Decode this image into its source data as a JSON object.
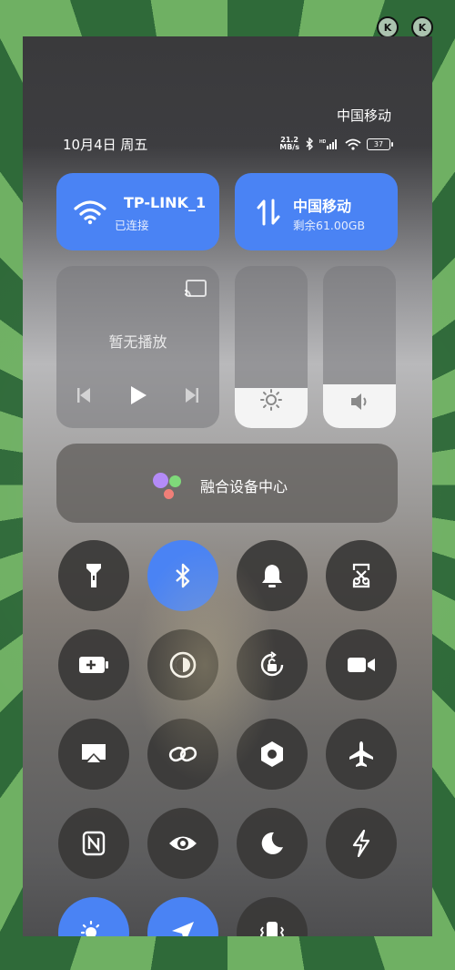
{
  "status_bar": {
    "carrier": "中国移动",
    "date": "10月4日 周五",
    "net_speed_value": "21.2",
    "net_speed_unit": "MB/s",
    "hd_label": "HD",
    "battery_level": "37"
  },
  "wifi_tile": {
    "title": "TP-LINK_1",
    "subtitle": "已连接",
    "icon": "wifi-icon"
  },
  "data_tile": {
    "title": "中国移动",
    "subtitle": "剩余61.00GB",
    "icon": "mobile-data-icon"
  },
  "media": {
    "status": "暂无播放"
  },
  "sliders": {
    "brightness_level": 0.25,
    "volume_level": 0.27
  },
  "device_hub": {
    "label": "融合设备中心"
  },
  "colors": {
    "accent": "#4a83f4",
    "button_dark": "#3a3837"
  },
  "toggles": [
    {
      "icon": "flashlight-icon",
      "active": false
    },
    {
      "icon": "bluetooth-icon",
      "active": true
    },
    {
      "icon": "bell-icon",
      "active": false
    },
    {
      "icon": "screenshot-icon",
      "active": false
    },
    {
      "icon": "battery-saver-icon",
      "active": false
    },
    {
      "icon": "dark-mode-icon",
      "active": false
    },
    {
      "icon": "rotation-lock-icon",
      "active": false
    },
    {
      "icon": "screen-record-icon",
      "active": false
    },
    {
      "icon": "screen-cast-icon",
      "active": false
    },
    {
      "icon": "link-icon",
      "active": false
    },
    {
      "icon": "settings-hex-icon",
      "active": false
    },
    {
      "icon": "airplane-icon",
      "active": false
    },
    {
      "icon": "nfc-icon",
      "active": false
    },
    {
      "icon": "eye-comfort-icon",
      "active": false
    },
    {
      "icon": "dnd-moon-icon",
      "active": false
    },
    {
      "icon": "power-saving-icon",
      "active": false
    },
    {
      "icon": "auto-brightness-icon",
      "active": true
    },
    {
      "icon": "location-icon",
      "active": true
    },
    {
      "icon": "vibrate-icon",
      "active": false
    }
  ]
}
